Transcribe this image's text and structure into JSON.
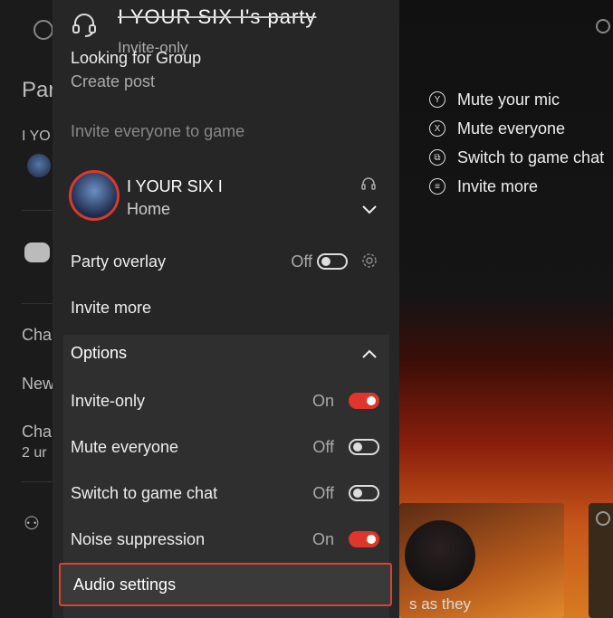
{
  "background": {
    "left_fragments": [
      "Par",
      "I YO",
      "Cha",
      "New",
      "Cha",
      "2 ur"
    ],
    "card_caption": "s as they"
  },
  "hints": [
    {
      "button": "Y",
      "label": "Mute your mic"
    },
    {
      "button": "X",
      "label": "Mute everyone"
    },
    {
      "button": "⧉",
      "label": "Switch to game chat"
    },
    {
      "button": "≡",
      "label": "Invite more"
    }
  ],
  "header": {
    "title": "I YOUR SIX I's party",
    "subtitle": "Invite-only",
    "icon": "headset-icon"
  },
  "lfg": {
    "title": "Looking for Group",
    "action": "Create post"
  },
  "invite_everyone": "Invite everyone to game",
  "member": {
    "name": "I YOUR SIX I",
    "status": "Home",
    "accent": "#d83a2c"
  },
  "party_overlay": {
    "label": "Party overlay",
    "state": "Off",
    "on": false
  },
  "invite_more": "Invite more",
  "options": {
    "title": "Options",
    "items": [
      {
        "label": "Invite-only",
        "state": "On",
        "on": true
      },
      {
        "label": "Mute everyone",
        "state": "Off",
        "on": false
      },
      {
        "label": "Switch to game chat",
        "state": "Off",
        "on": false
      },
      {
        "label": "Noise suppression",
        "state": "On",
        "on": true
      }
    ],
    "audio_settings": "Audio settings"
  },
  "colors": {
    "accent": "#e0352a",
    "panel": "#262626",
    "options_bg": "#2f2f2f"
  }
}
